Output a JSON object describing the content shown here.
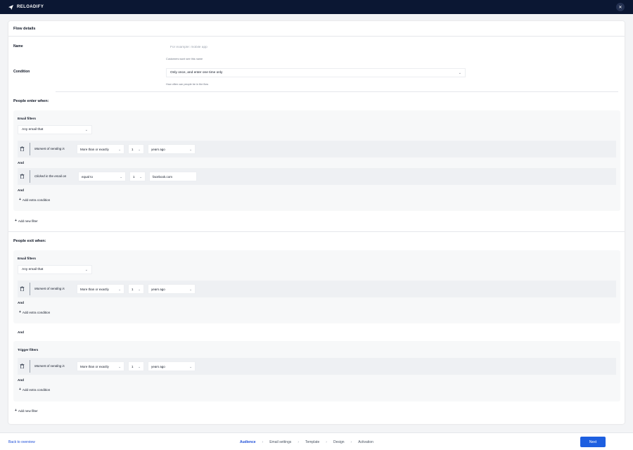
{
  "app": {
    "brand": "RELOADIFY"
  },
  "card": {
    "title": "Flow details"
  },
  "name_field": {
    "label": "Name",
    "placeholder": "For example: mobile app",
    "hint": "Customers wont see this name"
  },
  "condition_field": {
    "label": "Condition",
    "value": "Only once, and enter one time only",
    "hint": "How often can people be in the flow"
  },
  "enter": {
    "title": "People enter when:",
    "email_filters_label": "Email filters",
    "any_email": "Any email that",
    "row1": {
      "label": "Moment of sending is",
      "op": "More than or exactly",
      "num": "1",
      "unit": "years ago"
    },
    "and1": "And",
    "row2": {
      "label": "Clicked in the email on",
      "op": "equal to",
      "num": "1",
      "value": "facebook.com"
    },
    "and2": "And",
    "add_condition": "Add extra condition",
    "add_filter": "Add new filter"
  },
  "exit": {
    "title": "People exit when:",
    "email_filters_label": "Email filters",
    "any_email": "Any email that",
    "row1": {
      "label": "Moment of sending is",
      "op": "More than or exactly",
      "num": "1",
      "unit": "years ago"
    },
    "and1": "And",
    "add_condition": "Add extra condition",
    "and_between": "And",
    "trigger_filters_label": "Trigger filters",
    "row2": {
      "label": "Moment of sending is",
      "op": "More than or exactly",
      "num": "1",
      "unit": "years ago"
    },
    "and2": "And",
    "add_condition2": "Add extra condition",
    "add_filter": "Add new filter"
  },
  "footer": {
    "back": "Back to overview",
    "steps": [
      "Audience",
      "Email settings",
      "Template",
      "Design",
      "Activation"
    ],
    "next": "Next"
  }
}
